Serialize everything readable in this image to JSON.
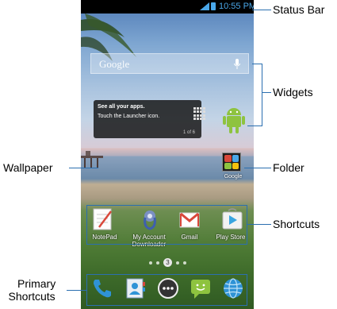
{
  "status_bar": {
    "time": "10:55 PM"
  },
  "search_widget": {
    "label": "Google"
  },
  "launcher_tip": {
    "title": "See all your apps.",
    "body": "Touch the Launcher icon.",
    "page": "1 of 6"
  },
  "folder": {
    "label": "Google"
  },
  "shortcuts": [
    {
      "label": "NotePad"
    },
    {
      "label": "My Account Downloader"
    },
    {
      "label": "Gmail"
    },
    {
      "label": "Play Store"
    }
  ],
  "page_indicator": {
    "current": "3"
  },
  "dock": [
    {
      "icon": "phone-icon"
    },
    {
      "icon": "contacts-icon"
    },
    {
      "icon": "launcher-icon"
    },
    {
      "icon": "messaging-icon"
    },
    {
      "icon": "browser-icon"
    }
  ],
  "callouts": {
    "status_bar": "Status Bar",
    "widgets": "Widgets",
    "folder": "Folder",
    "shortcuts": "Shortcuts",
    "wallpaper": "Wallpaper",
    "primary_shortcuts_line1": "Primary",
    "primary_shortcuts_line2": "Shortcuts"
  },
  "colors": {
    "callout_line": "#2b6fb0",
    "status_text": "#4aa7e8"
  }
}
